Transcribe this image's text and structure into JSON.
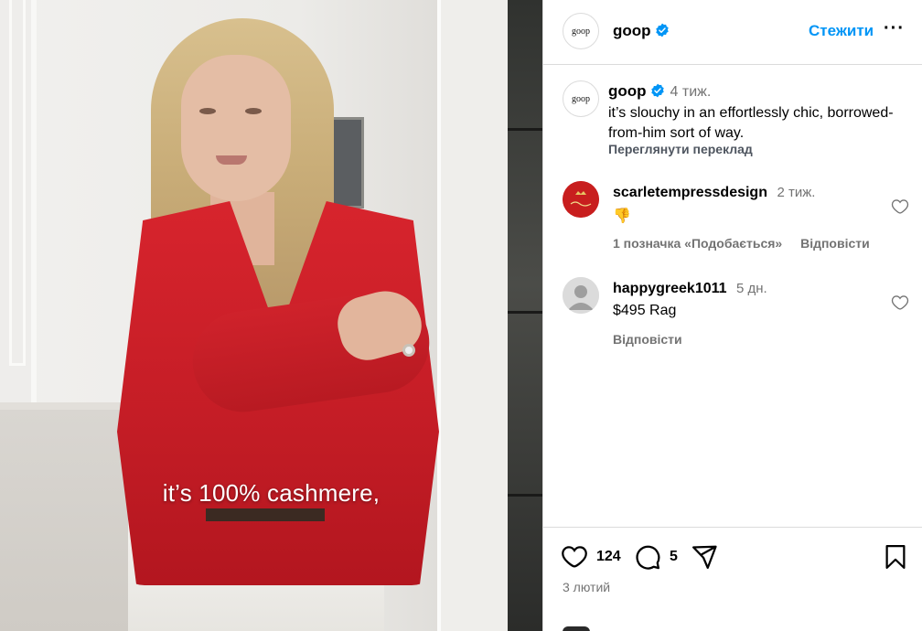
{
  "video": {
    "caption": "it’s 100% cashmere,"
  },
  "header": {
    "avatar_text": "goop",
    "username": "goop",
    "follow_label": "Стежити",
    "more_label": "···"
  },
  "post": {
    "avatar_text": "goop",
    "username": "goop",
    "time": "4 тиж.",
    "text": "it’s slouchy in an effortlessly chic, borrowed-from-him sort of way.",
    "see_translation": "Переглянути переклад"
  },
  "comments": [
    {
      "username": "scarletempressdesign",
      "time": "2 тиж.",
      "text": "👎",
      "likes": "1 позначка «Подобається»",
      "reply": "Відповісти"
    },
    {
      "username": "happygreek1011",
      "time": "5 дн.",
      "text": "$495 Rag",
      "reply": "Відповісти"
    }
  ],
  "actions": {
    "like_count": "124",
    "comment_count": "5",
    "date": "3 лютий"
  },
  "colors": {
    "accent": "#0095f6",
    "verified": "#0095f6",
    "secondary_text": "#737373",
    "border": "#dbdbdb"
  },
  "icons": [
    "verified-badge-icon",
    "heart-icon",
    "comment-icon",
    "share-icon",
    "bookmark-icon",
    "more-icon",
    "avatar-placeholder-icon"
  ]
}
